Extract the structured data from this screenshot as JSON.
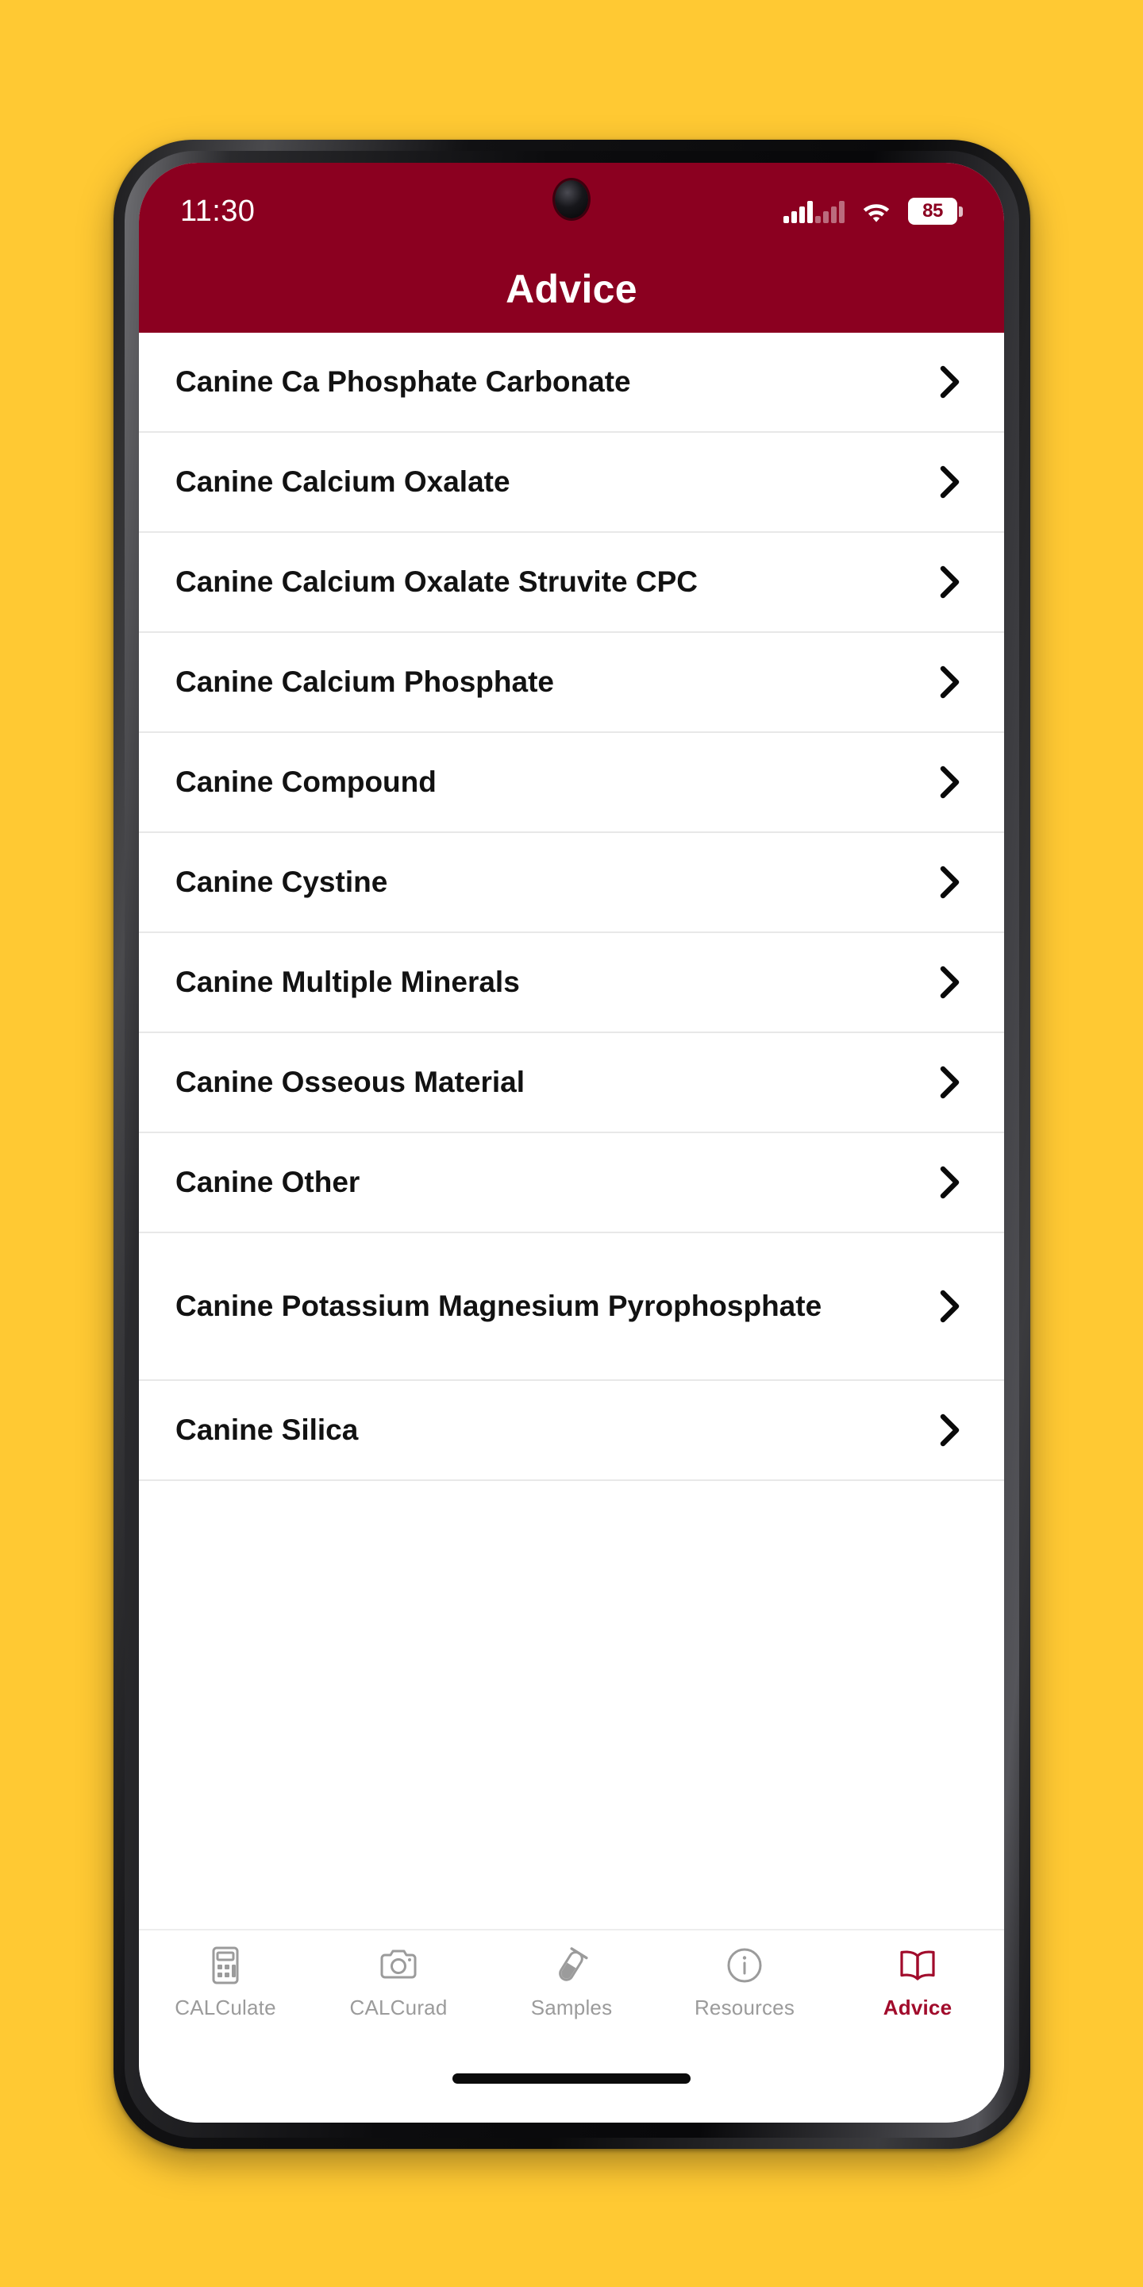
{
  "background_color": "#FFC933",
  "brand": {
    "primary": "#8B0020",
    "accent": "#A10B2B"
  },
  "status_bar": {
    "time": "11:30",
    "signal_icon": "signal-bars-icon",
    "wifi_icon": "wifi-icon",
    "battery_icon": "battery-icon",
    "battery_level": "85"
  },
  "app_bar": {
    "title": "Advice"
  },
  "advice_list": {
    "chevron_icon": "chevron-right-icon",
    "items": [
      {
        "label": "Canine Ca Phosphate Carbonate",
        "two_line": false
      },
      {
        "label": "Canine Calcium Oxalate",
        "two_line": false
      },
      {
        "label": "Canine Calcium Oxalate Struvite CPC",
        "two_line": false
      },
      {
        "label": "Canine Calcium Phosphate",
        "two_line": false
      },
      {
        "label": "Canine Compound",
        "two_line": false
      },
      {
        "label": "Canine Cystine",
        "two_line": false
      },
      {
        "label": "Canine Multiple Minerals",
        "two_line": false
      },
      {
        "label": "Canine Osseous Material",
        "two_line": false
      },
      {
        "label": "Canine Other",
        "two_line": false
      },
      {
        "label": "Canine Potassium Magnesium Pyrophosphate",
        "two_line": true
      },
      {
        "label": "Canine Silica",
        "two_line": false
      }
    ]
  },
  "tab_bar": {
    "items": [
      {
        "label": "CALCulate",
        "icon": "calculator-icon",
        "active": false
      },
      {
        "label": "CALCurad",
        "icon": "camera-icon",
        "active": false
      },
      {
        "label": "Samples",
        "icon": "test-tube-icon",
        "active": false
      },
      {
        "label": "Resources",
        "icon": "info-circle-icon",
        "active": false
      },
      {
        "label": "Advice",
        "icon": "open-book-icon",
        "active": true
      }
    ]
  }
}
